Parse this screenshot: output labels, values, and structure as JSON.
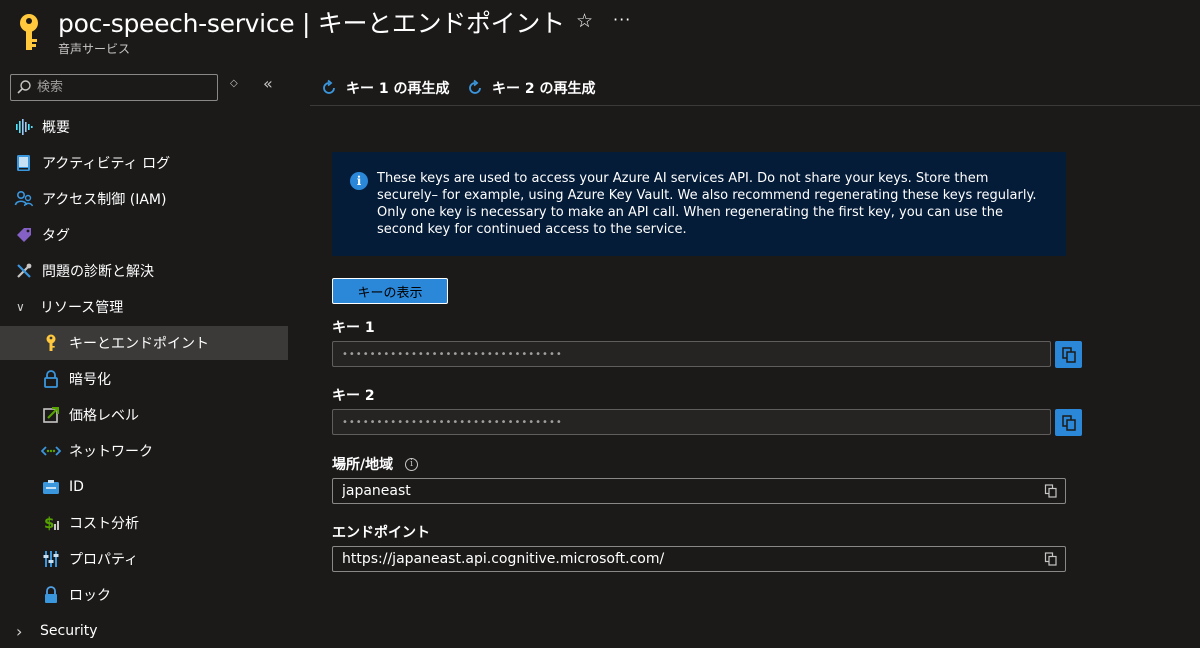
{
  "header": {
    "title": "poc-speech-service | キーとエンドポイント",
    "subtitle": "音声サービス",
    "star_glyph": "☆",
    "more_glyph": "···"
  },
  "sidebar": {
    "search_placeholder": "検索",
    "updown_glyph": "◇",
    "collapse_glyph": "«",
    "items": [
      {
        "label": "概要",
        "icon": "overview-waveform-icon",
        "level": 0
      },
      {
        "label": "アクティビティ ログ",
        "icon": "activity-log-icon",
        "level": 0
      },
      {
        "label": "アクセス制御 (IAM)",
        "icon": "access-control-icon",
        "level": 0
      },
      {
        "label": "タグ",
        "icon": "tag-icon",
        "level": 0
      },
      {
        "label": "問題の診断と解決",
        "icon": "wrench-icon",
        "level": 0
      },
      {
        "label": "リソース管理",
        "icon": "chevron-down-icon",
        "level": 0,
        "expander": "∨"
      },
      {
        "label": "キーとエンドポイント",
        "icon": "key-icon",
        "level": 1,
        "selected": true
      },
      {
        "label": "暗号化",
        "icon": "lock-icon",
        "level": 1
      },
      {
        "label": "価格レベル",
        "icon": "pricing-tier-icon",
        "level": 1
      },
      {
        "label": "ネットワーク",
        "icon": "network-icon",
        "level": 1
      },
      {
        "label": "ID",
        "icon": "identity-icon",
        "level": 1
      },
      {
        "label": "コスト分析",
        "icon": "cost-analysis-icon",
        "level": 1
      },
      {
        "label": "プロパティ",
        "icon": "properties-icon",
        "level": 1
      },
      {
        "label": "ロック",
        "icon": "lock-icon",
        "level": 1
      },
      {
        "label": "Security",
        "icon": "chevron-right-icon",
        "level": 0,
        "expander": "›"
      }
    ]
  },
  "toolbar": {
    "regen_key1": "キー 1 の再生成",
    "regen_key2": "キー 2 の再生成"
  },
  "info": {
    "text": "These keys are used to access your Azure AI services API. Do not share your keys. Store them securely– for example, using Azure Key Vault. We also recommend regenerating these keys regularly. Only one key is necessary to make an API call. When regenerating the first key, you can use the second key for continued access to the service."
  },
  "show_keys_label": "キーの表示",
  "key1": {
    "label": "キー 1",
    "value": "••••••••••••••••••••••••••••••••"
  },
  "key2": {
    "label": "キー 2",
    "value": "••••••••••••••••••••••••••••••••"
  },
  "location": {
    "label": "場所/地域",
    "value": "japaneast"
  },
  "endpoint": {
    "label": "エンドポイント",
    "value": "https://japaneast.api.cognitive.microsoft.com/"
  },
  "colors": {
    "accent": "#2b88d8",
    "info_bg": "#051c39",
    "key_yellow": "#ffc83d"
  }
}
